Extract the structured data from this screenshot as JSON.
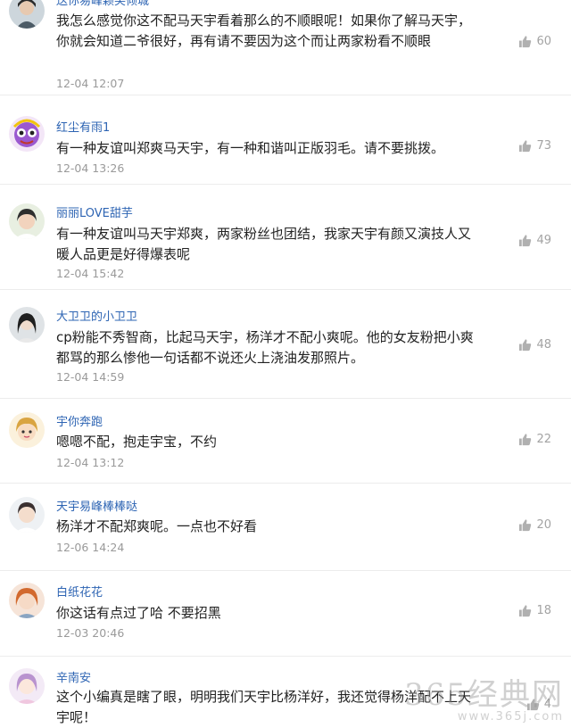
{
  "comments": [
    {
      "username": "送你易峰颖笑倾城",
      "text": "我怎么感觉你这不配马天宇看着那么的不顺眼呢！如果你了解马天宇，你就会知道二爷很好，再有请不要因为这个而让两家粉看不顺眼",
      "time": "12-04 12:07",
      "likes": "60"
    },
    {
      "username": "红尘有雨1",
      "text": "有一种友谊叫郑爽马天宇，有一种和谐叫正版羽毛。请不要挑拨。",
      "time": "12-04 13:26",
      "likes": "73"
    },
    {
      "username": "丽丽LOVE甜芋",
      "text": "有一种友谊叫马天宇郑爽，两家粉丝也团结，我家天宇有颜又演技人又暖人品更是好得爆表呢",
      "time": "12-04 15:42",
      "likes": "49"
    },
    {
      "username": "大卫卫的小卫卫",
      "text": "cp粉能不秀智商，比起马天宇，杨洋才不配小爽呢。他的女友粉把小爽都骂的那么惨他一句话都不说还火上浇油发那照片。",
      "time": "12-04 14:59",
      "likes": "48"
    },
    {
      "username": "宇你奔跑",
      "text": "嗯嗯不配，抱走宇宝，不约",
      "time": "12-04 13:12",
      "likes": "22"
    },
    {
      "username": "天宇易峰棒棒哒",
      "text": "杨洋才不配郑爽呢。一点也不好看",
      "time": "12-06 14:24",
      "likes": "20"
    },
    {
      "username": "白纸花花",
      "text": "你这话有点过了哈 不要招黑",
      "time": "12-03 20:46",
      "likes": "18"
    },
    {
      "username": "辛南安",
      "text": "这个小编真是瞎了眼，明明我们天宇比杨洋好，我还觉得杨洋配不上天宇呢！",
      "time": "",
      "likes": "4"
    }
  ],
  "watermark": {
    "main": "365经典网",
    "url": "www.365j.com"
  },
  "colors": {
    "username": "#2d64b3",
    "text": "#222222",
    "time": "#9a9a9a",
    "like": "#a3a3a3"
  },
  "icons": {
    "like": "thumbs-up-icon"
  }
}
